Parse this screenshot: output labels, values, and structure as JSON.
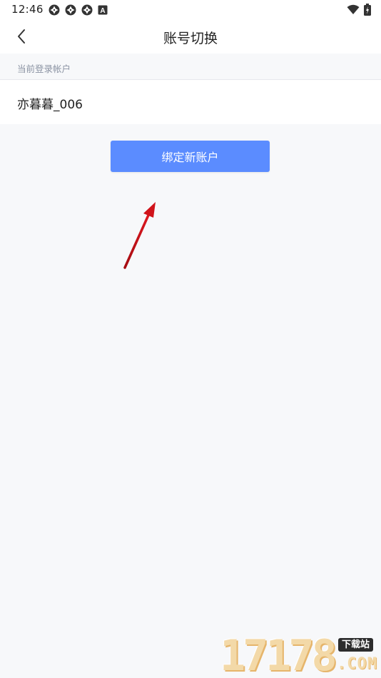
{
  "status_bar": {
    "time": "12:46",
    "left_icons": [
      "aperture-icon",
      "aperture-icon",
      "aperture-icon",
      "a-badge-icon"
    ],
    "a_badge_label": "A",
    "right_icons": [
      "wifi-icon",
      "battery-charging-icon"
    ]
  },
  "nav": {
    "title": "账号切换",
    "back_icon": "chevron-left-icon"
  },
  "current_account": {
    "section_label": "当前登录帐户",
    "account_name": "亦暮暮_006"
  },
  "actions": {
    "bind_label": "绑定新账户"
  },
  "annotation": {
    "arrow_icon": "red-arrow-icon",
    "color": "#d0131a"
  },
  "watermark": {
    "digits": "17178",
    "tag": "下载站",
    "suffix": ".COM"
  },
  "colors": {
    "primary": "#5b8cff",
    "background": "#f7f8fa",
    "muted_text": "#8b93a3"
  }
}
